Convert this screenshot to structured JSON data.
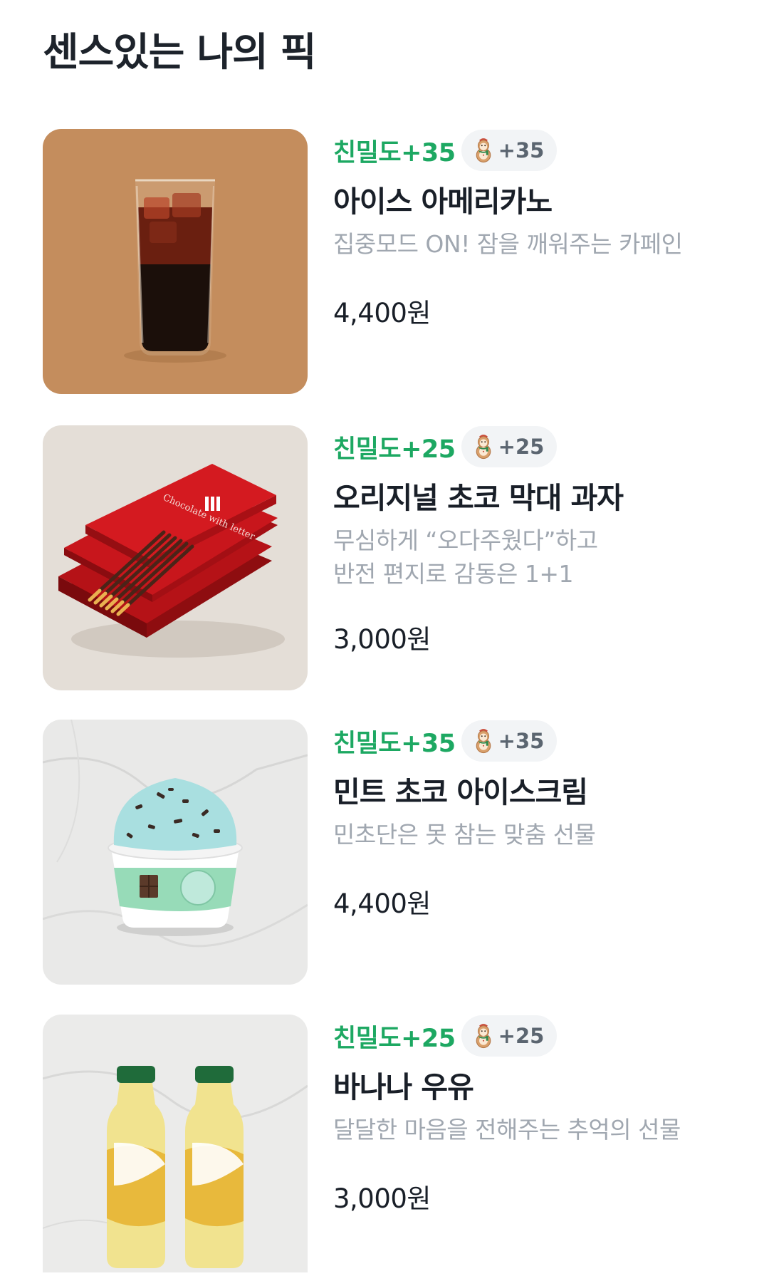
{
  "section": {
    "title": "센스있는 나의 픽"
  },
  "colors": {
    "affinity": "#1da862",
    "chip_bg": "#f2f4f6",
    "description": "#a0a7b0"
  },
  "products": [
    {
      "affinity": "친밀도+35",
      "points": "+35",
      "point_icon": "snowman-cookie-icon",
      "name": "아이스 아메리카노",
      "description_lines": [
        "집중모드 ON! 잠을 깨워주는 카페인"
      ],
      "price": "4,400원",
      "image": "iced-americano-image"
    },
    {
      "affinity": "친밀도+25",
      "points": "+25",
      "point_icon": "snowman-cookie-icon",
      "name": "오리지널 초코 막대 과자",
      "description_lines": [
        "무심하게 “오다주웠다”하고",
        "반전 편지로 감동은 1+1"
      ],
      "price": "3,000원",
      "image": "chocolate-stick-snack-image",
      "image_text": "Chocolate with letter"
    },
    {
      "affinity": "친밀도+35",
      "points": "+35",
      "point_icon": "snowman-cookie-icon",
      "name": "민트 초코 아이스크림",
      "description_lines": [
        "민초단은 못 참는 맞춤 선물"
      ],
      "price": "4,400원",
      "image": "mint-choco-ice-cream-image"
    },
    {
      "affinity": "친밀도+25",
      "points": "+25",
      "point_icon": "snowman-cookie-icon",
      "name": "바나나 우유",
      "description_lines": [
        "달달한 마음을 전해주는 추억의 선물"
      ],
      "price": "3,000원",
      "image": "banana-milk-image"
    }
  ]
}
